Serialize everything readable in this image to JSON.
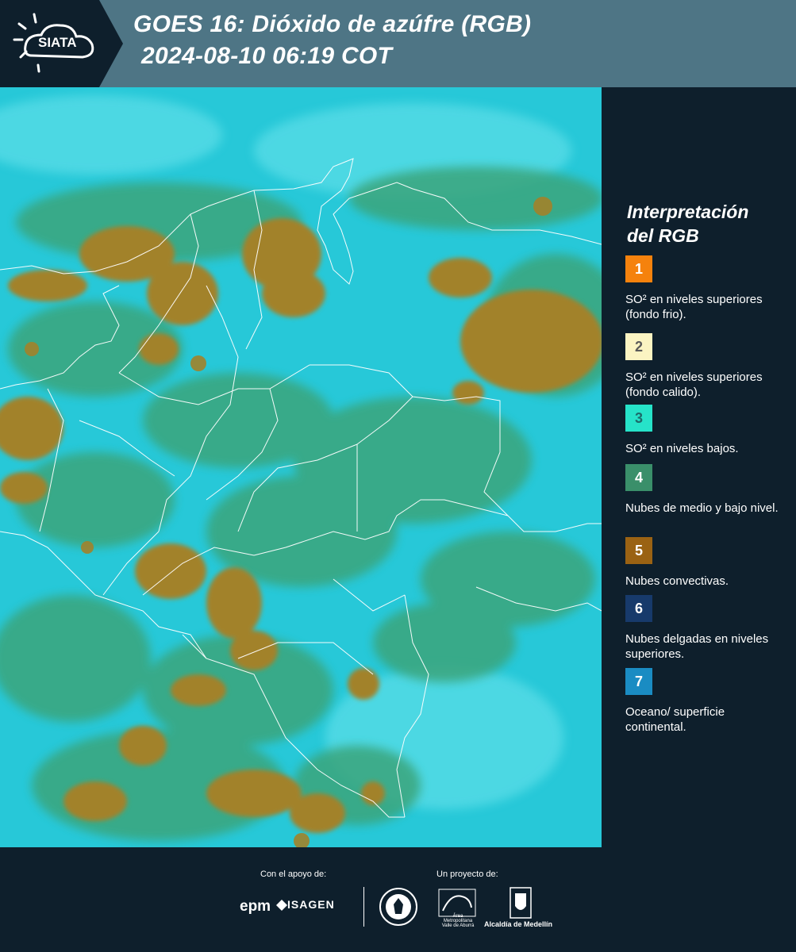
{
  "header": {
    "logo_text": "SIATA",
    "title_line1": "GOES 16: Dióxido de azúfre (RGB)",
    "title_line2": "2024-08-10 06:19 COT"
  },
  "legend": {
    "title_line1": "Interpretación",
    "title_line2": "del RGB",
    "items": [
      {
        "number": "1",
        "color": "#f5820d",
        "desc": "SO² en niveles superiores (fondo frio)."
      },
      {
        "number": "2",
        "color": "#fbf4c2",
        "desc": "SO² en niveles superiores (fondo calido)."
      },
      {
        "number": "3",
        "color": "#26e3c9",
        "desc": "SO² en niveles bajos."
      },
      {
        "number": "4",
        "color": "#3a8f6a",
        "desc": "Nubes de medio y bajo nivel."
      },
      {
        "number": "5",
        "color": "#9a6213",
        "desc": "Nubes convectivas."
      },
      {
        "number": "6",
        "color": "#173a6b",
        "desc": "Nubes delgadas en niveles superiores."
      },
      {
        "number": "7",
        "color": "#1a8cc3",
        "desc": "Oceano/ superficie continental."
      }
    ]
  },
  "footer": {
    "support_label": "Con el apoyo de:",
    "project_label": "Un proyecto de:",
    "epm_logo": "epm",
    "isagen_logo": "ISAGEN",
    "area_logo": "Área Metropolitana Valle de Aburrá",
    "alcaldia_logo": "Alcaldía de Medellín"
  },
  "map": {
    "ocean_color": "#1fc9d9",
    "green_cloud_color": "#3aa57c",
    "convective_cloud_color": "#a2822a",
    "border_color": "#ffffff"
  }
}
